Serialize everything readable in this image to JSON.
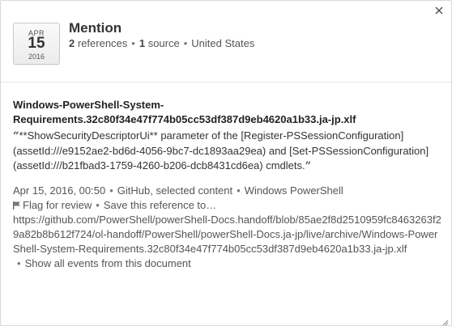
{
  "popup": {
    "calendar": {
      "month": "APR",
      "day": "15",
      "year": "2016"
    },
    "title": "Mention",
    "meta": {
      "references_count": "2",
      "references_label": "references",
      "sources_count": "1",
      "sources_label": "source",
      "country": "United States"
    },
    "mention": {
      "doc_title": "Windows-PowerShell-System-Requirements.32c80f34e47f774b05cc53df387d9eb4620a1b33.ja-jp.xlf",
      "quote_open": "“",
      "quote_text": "**ShowSecurityDescriptorUi** parameter of the [Register-PSSessionConfiguration](assetId:///e9152ae2-bd6d-4056-9bc7-dc1893aa29ea) and [Set-PSSessionConfiguration](assetId:///b21fbad3-1759-4260-b206-dcb8431cd6ea) cmdlets.",
      "quote_close": "”",
      "date": "Apr 15, 2016, 00:50",
      "source": "GitHub, selected content",
      "category": "Windows PowerShell",
      "flag_label": "Flag for review",
      "save_label": "Save this reference to…",
      "url": "https://github.com/PowerShell/powerShell-Docs.handoff/blob/85ae2f8d2510959fc8463263f29a82b8b612f724/ol-handoff/PowerShell/powerShell-Docs.ja-jp/live/archive/Windows-PowerShell-System-Requirements.32c80f34e47f774b05cc53df387d9eb4620a1b33.ja-jp.xlf",
      "show_all_label": "Show all events from this document"
    }
  }
}
